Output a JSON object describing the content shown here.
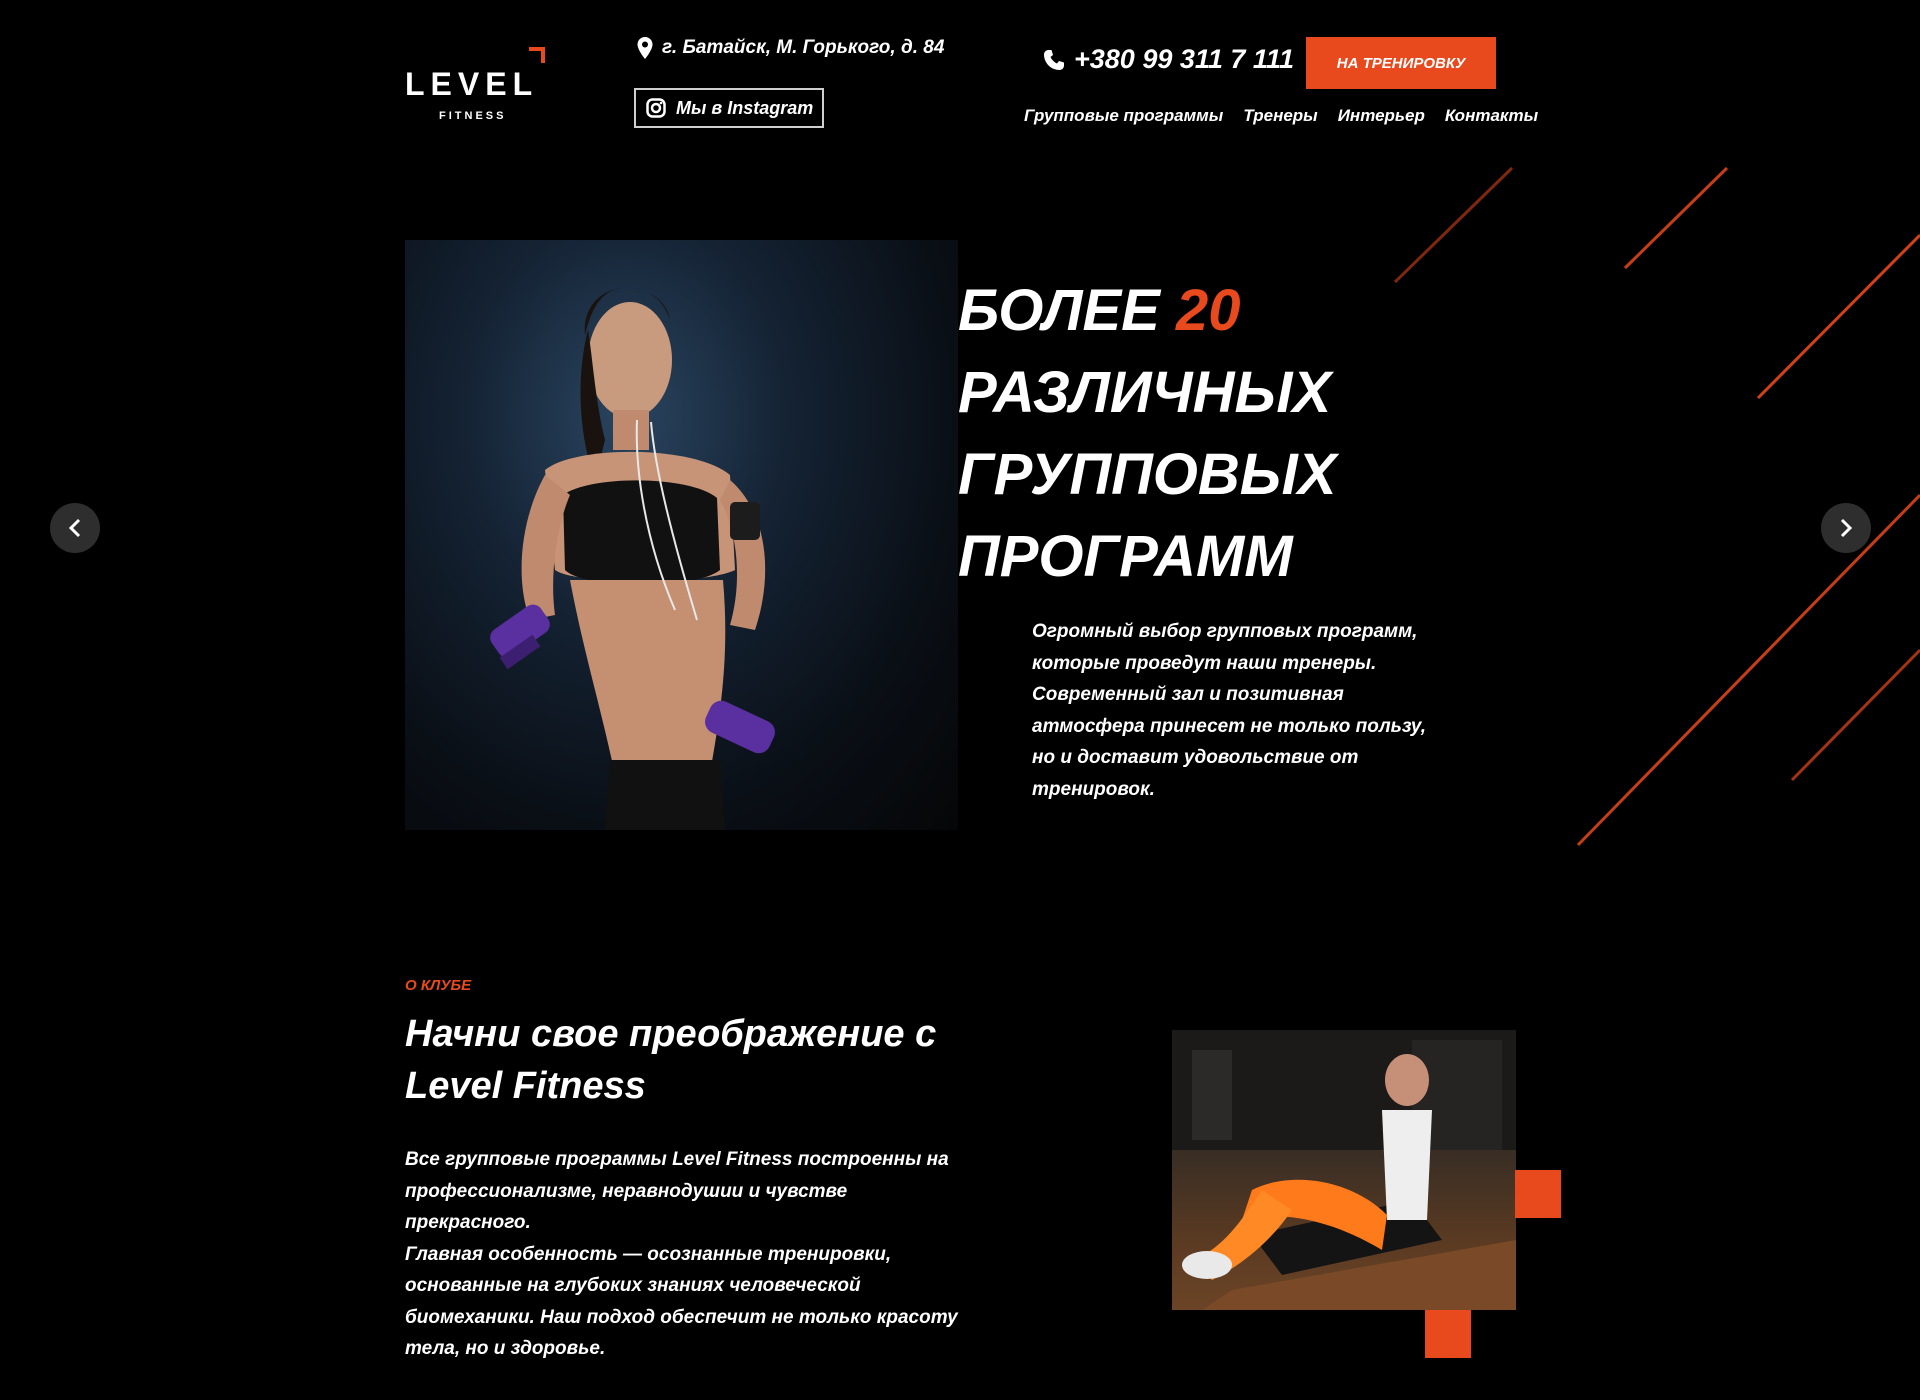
{
  "header": {
    "logo": {
      "word": "LEVEL",
      "sub": "FITNESS"
    },
    "address": "г. Батайск, М. Горького, д. 84",
    "instagram_label": "Мы в Instagram",
    "phone": "+380 99 311 7 111",
    "cta_label": "НА ТРЕНИРОВКУ",
    "nav": [
      "Групповые программы",
      "Тренеры",
      "Интерьер",
      "Контакты"
    ]
  },
  "hero": {
    "title_prefix": "Более",
    "title_number": "20",
    "title_line2": "различных",
    "title_line3": "групповых",
    "title_line4": "программ",
    "text": "Огромный выбор групповых программ, которые проведут наши тренеры. Современный зал и позитивная атмосфера принесет не только пользу, но и доставит удовольствие от тренировок."
  },
  "about": {
    "label": "О КЛУБЕ",
    "title": "Начни свое преображение с Level Fitness",
    "text1": "Все групповые программы Level Fitness построенны на профессионализме, неравнодушии и чувстве прекрасного.",
    "text2": "Главная особенность — осознанные тренировки, основанные на глубоких знаниях человеческой биомеханики. Наш подход обеспечит не только красоту тела, но и здоровье."
  },
  "colors": {
    "accent": "#e8491d",
    "background": "#000000",
    "arrow_bg": "#2e2e2e"
  },
  "icons": [
    "map-pin-icon",
    "instagram-icon",
    "phone-icon",
    "chevron-left-icon",
    "chevron-right-icon"
  ]
}
